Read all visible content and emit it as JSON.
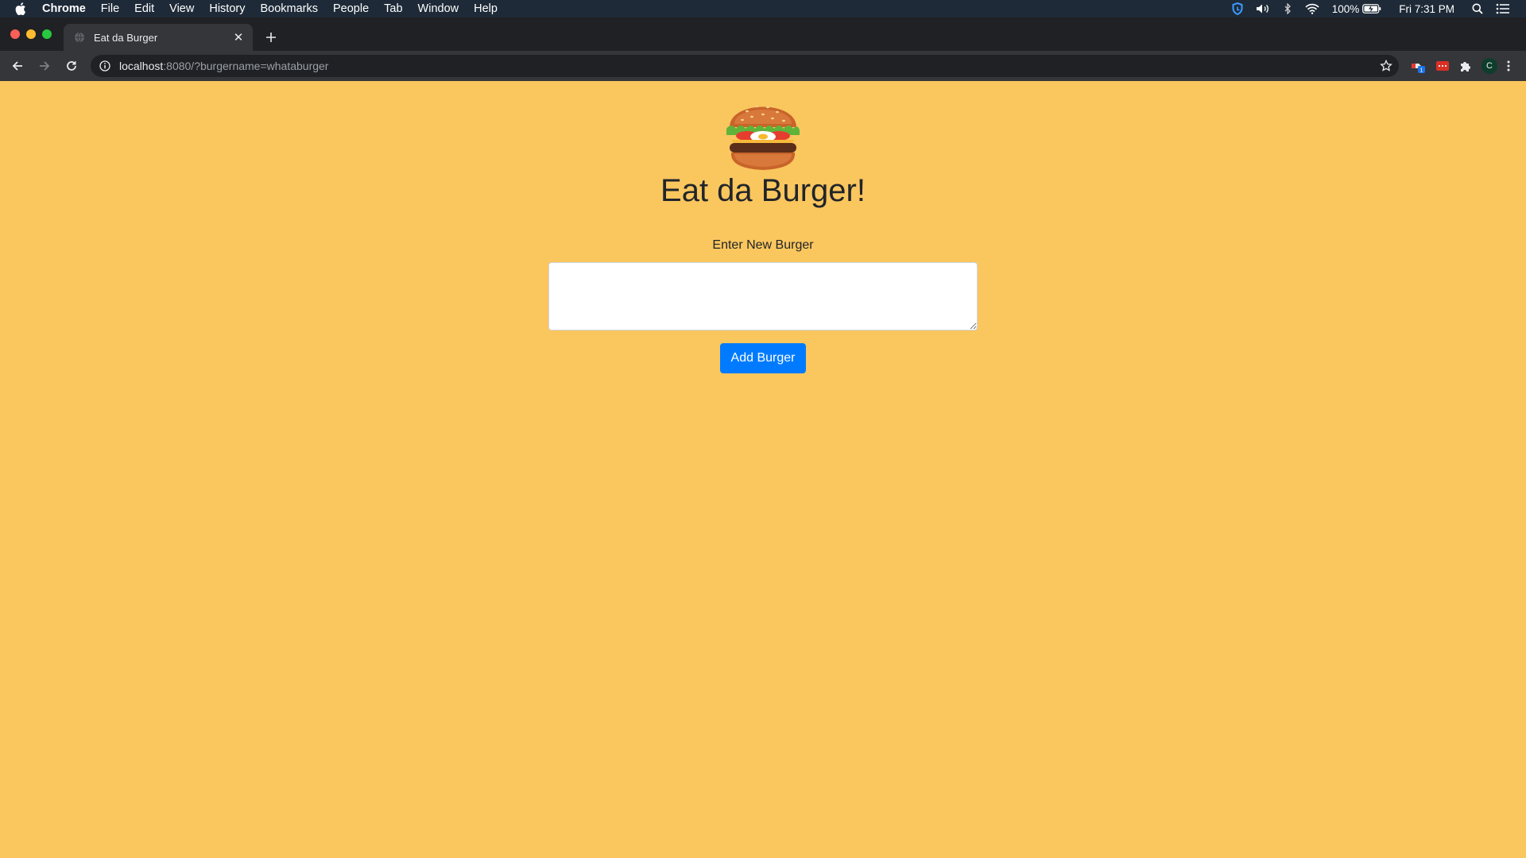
{
  "menubar": {
    "app_name": "Chrome",
    "items": [
      "File",
      "Edit",
      "View",
      "History",
      "Bookmarks",
      "People",
      "Tab",
      "Window",
      "Help"
    ],
    "battery": "100%",
    "clock": "Fri 7:31 PM"
  },
  "browser": {
    "tab_title": "Eat da Burger",
    "url_host": "localhost",
    "url_rest": ":8080/?burgername=whataburger",
    "profile_initial": "C"
  },
  "page": {
    "title": "Eat da Burger!",
    "input_label": "Enter New Burger",
    "input_value": "",
    "button_label": "Add Burger",
    "background_color": "#fac65e",
    "button_color": "#007bff"
  }
}
